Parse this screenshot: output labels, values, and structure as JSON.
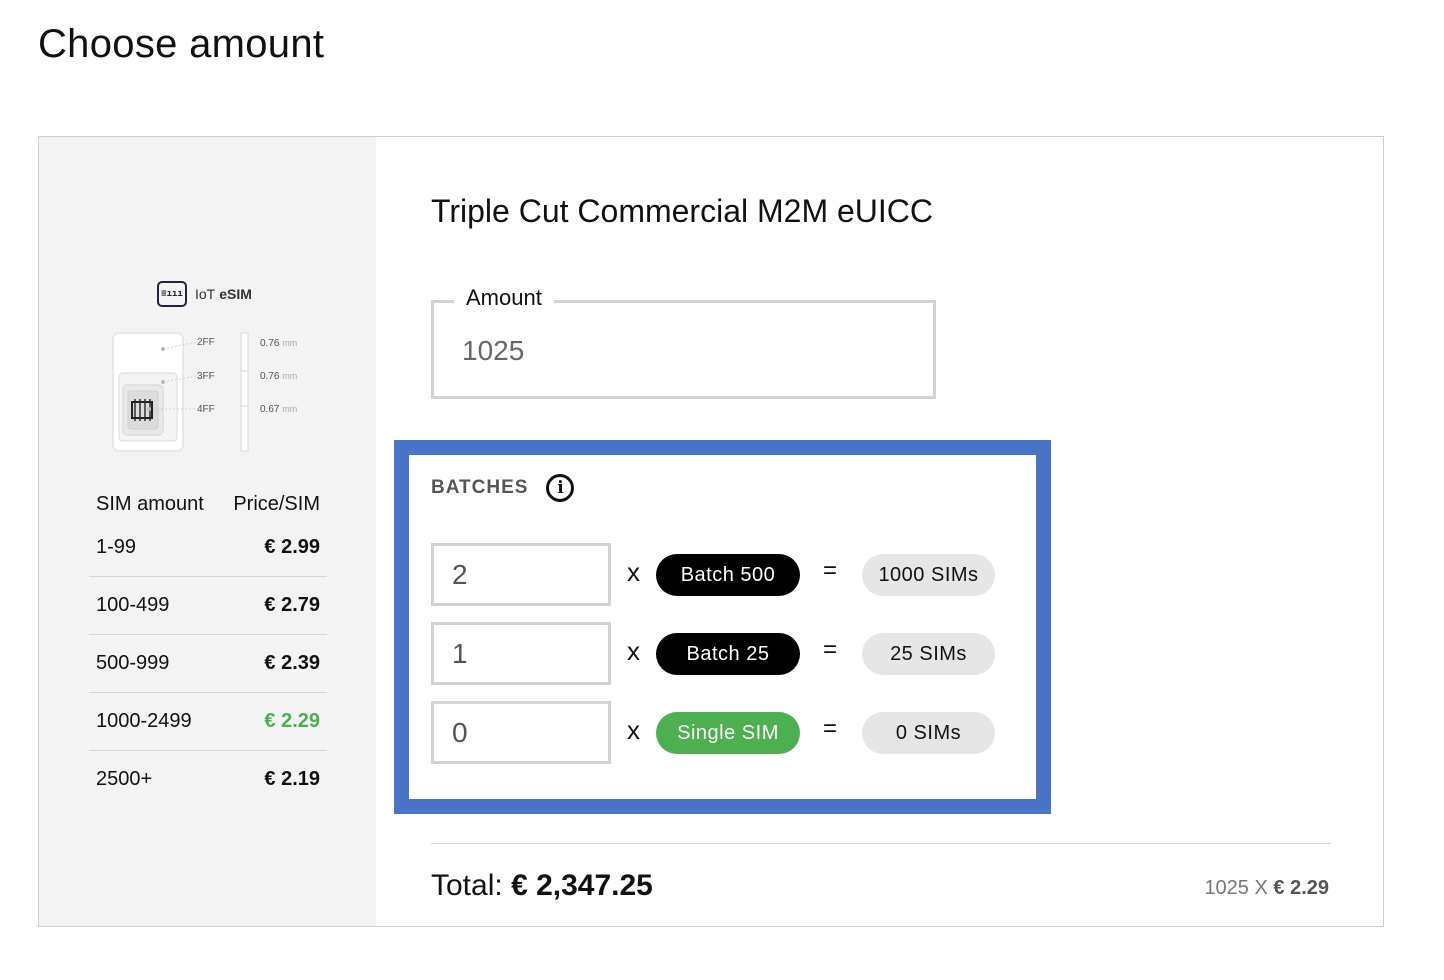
{
  "page": {
    "title": "Choose amount"
  },
  "product": {
    "name": "Triple Cut Commercial M2M eUICC"
  },
  "sim_image": {
    "logo_text_prefix": "IoT",
    "logo_text_bold": "eSIM",
    "logo_icon_text": "≡ııı",
    "cuts": [
      {
        "label": "2FF",
        "thickness": "0.76",
        "unit": "mm"
      },
      {
        "label": "3FF",
        "thickness": "0.76",
        "unit": "mm"
      },
      {
        "label": "4FF",
        "thickness": "0.67",
        "unit": "mm"
      }
    ]
  },
  "pricing": {
    "header_amount": "SIM amount",
    "header_price": "Price/SIM",
    "rows": [
      {
        "range": "1-99",
        "price": "€ 2.99",
        "active": false
      },
      {
        "range": "100-499",
        "price": "€ 2.79",
        "active": false
      },
      {
        "range": "500-999",
        "price": "€ 2.39",
        "active": false
      },
      {
        "range": "1000-2499",
        "price": "€ 2.29",
        "active": true
      },
      {
        "range": "2500+",
        "price": "€ 2.19",
        "active": false
      }
    ],
    "active_color": "#4caf50"
  },
  "amount": {
    "label": "Amount",
    "value": "1025"
  },
  "batches": {
    "label": "BATCHES",
    "info_icon": "info-circle-icon",
    "highlight_color": "#4a74c8",
    "rows": [
      {
        "quantity": "2",
        "multiplier": "x",
        "type": "Batch 500",
        "equals": "=",
        "result": "1000 SIMs"
      },
      {
        "quantity": "1",
        "multiplier": "x",
        "type": "Batch 25",
        "equals": "=",
        "result": "25 SIMs"
      },
      {
        "quantity": "0",
        "multiplier": "x",
        "type": "Single SIM",
        "equals": "=",
        "result": "0 SIMs"
      }
    ]
  },
  "total": {
    "label": "Total:",
    "value": "€ 2,347.25",
    "summary_qty": "1025 X",
    "summary_price": "€ 2.29"
  }
}
